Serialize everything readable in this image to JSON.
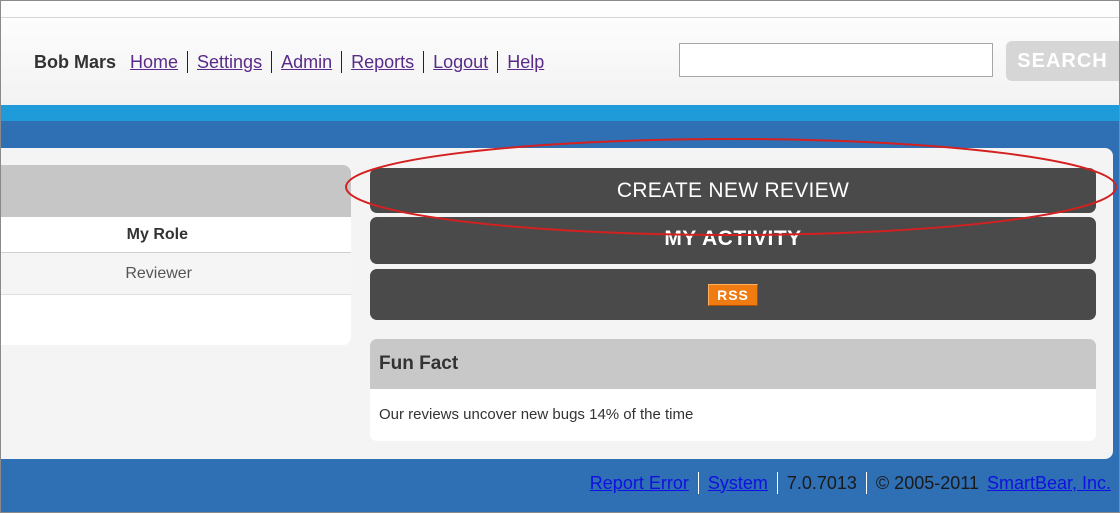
{
  "header": {
    "user_name": "Bob Mars",
    "nav": [
      {
        "label": "Home"
      },
      {
        "label": "Settings"
      },
      {
        "label": "Admin"
      },
      {
        "label": "Reports"
      },
      {
        "label": "Logout"
      },
      {
        "label": "Help"
      }
    ],
    "search": {
      "value": "",
      "placeholder": "",
      "button_label": "SEARCH"
    }
  },
  "reviews_table": {
    "column_header": "My Role",
    "rows": [
      {
        "role": "Reviewer"
      }
    ]
  },
  "actions": {
    "create_review": "CREATE NEW REVIEW",
    "my_activity": "MY ACTIVITY",
    "rss": "RSS"
  },
  "fun_fact": {
    "title": "Fun Fact",
    "text": "Our reviews uncover new bugs 14% of the time"
  },
  "footer": {
    "report_error": "Report Error",
    "system": "System",
    "version": "7.0.7013",
    "copyright": "© 2005-2011",
    "company": "SmartBear, Inc."
  },
  "colors": {
    "accent_blue": "#2f6fb4",
    "cyan": "#1f9bd9",
    "button_dark": "#4a4a4a",
    "rss_orange": "#f07b10",
    "highlight_red": "#d42020"
  }
}
